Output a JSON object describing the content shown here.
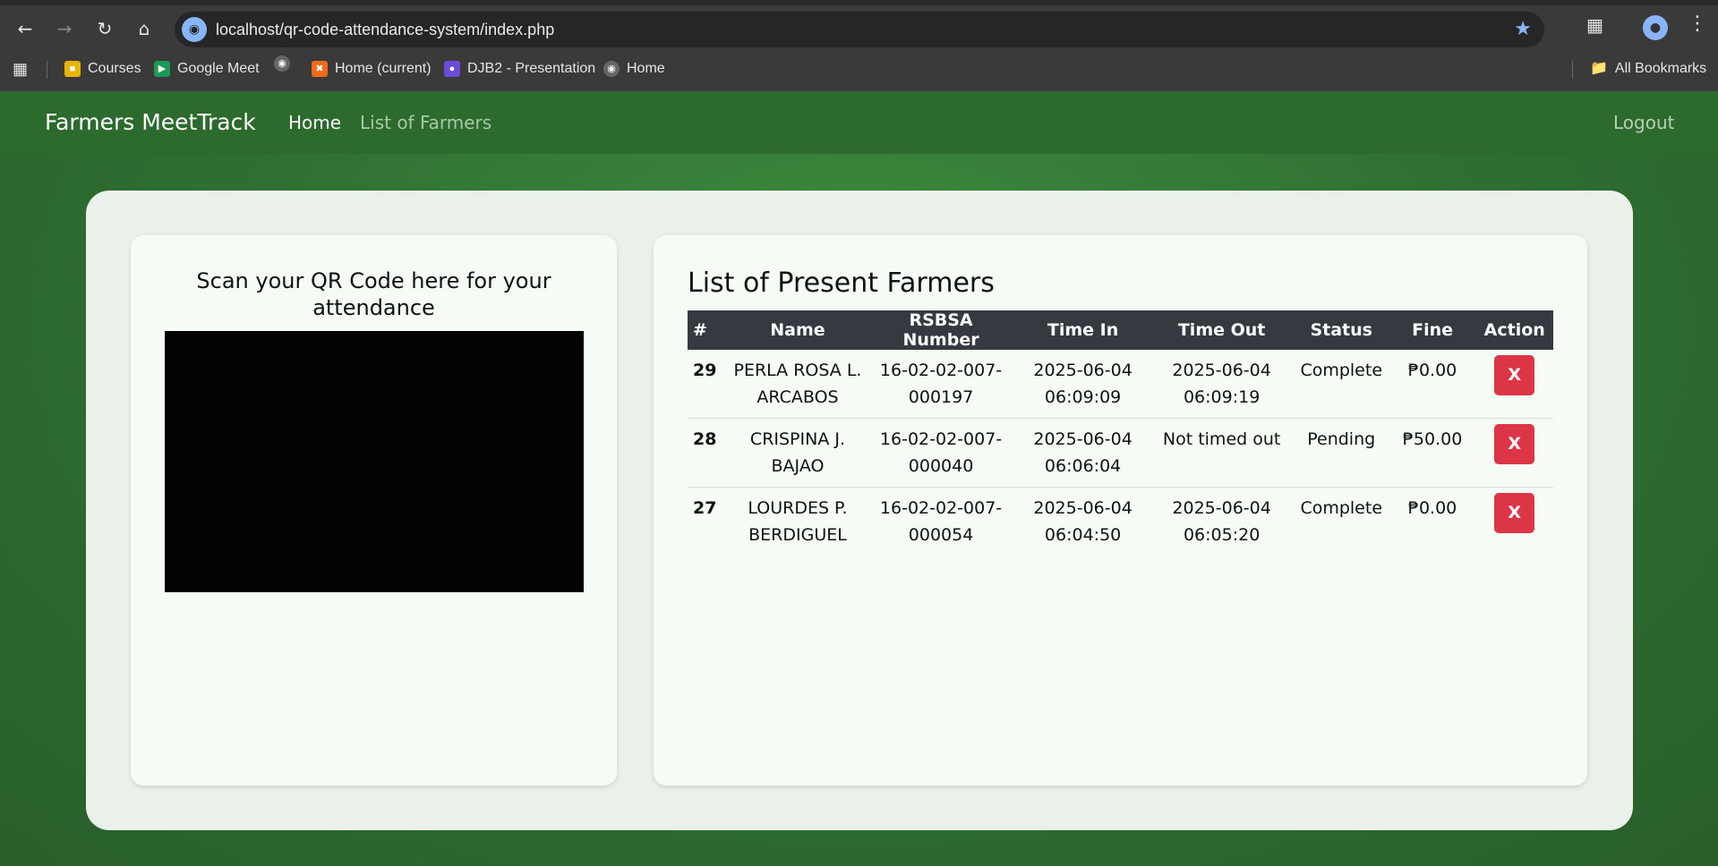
{
  "browser": {
    "url": "localhost/qr-code-attendance-system/index.php",
    "bookmarks": [
      "Courses",
      "Google Meet",
      "Home (current)",
      "DJB2 - Presentation",
      "Home"
    ],
    "all_bookmarks": "All Bookmarks"
  },
  "nav": {
    "brand": "Farmers MeetTrack",
    "links": [
      "Home",
      "List of Farmers"
    ],
    "logout": "Logout"
  },
  "scanner": {
    "title": "Scan your QR Code here for your attendance"
  },
  "attendance": {
    "title": "List of Present Farmers",
    "columns": [
      "#",
      "Name",
      "RSBSA Number",
      "Time In",
      "Time Out",
      "Status",
      "Fine",
      "Action"
    ],
    "rows": [
      {
        "id": "29",
        "name": "PERLA ROSA L. ARCABOS",
        "rsbsa": "16-02-02-007-000197",
        "time_in": "2025-06-04 06:09:09",
        "time_out": "2025-06-04 06:09:19",
        "status": "Complete",
        "fine": "₱0.00",
        "action": "X"
      },
      {
        "id": "28",
        "name": "CRISPINA J. BAJAO",
        "rsbsa": "16-02-02-007-000040",
        "time_in": "2025-06-04 06:06:04",
        "time_out": "Not timed out",
        "status": "Pending",
        "fine": "₱50.00",
        "action": "X"
      },
      {
        "id": "27",
        "name": "LOURDES P. BERDIGUEL",
        "rsbsa": "16-02-02-007-000054",
        "time_in": "2025-06-04 06:04:50",
        "time_out": "2025-06-04 06:05:20",
        "status": "Complete",
        "fine": "₱0.00",
        "action": "X"
      }
    ]
  },
  "colors": {
    "navbar": "#2c6a2e",
    "background": "#3a8a3c",
    "table_header": "#343a40",
    "delete_button": "#dc3545"
  }
}
